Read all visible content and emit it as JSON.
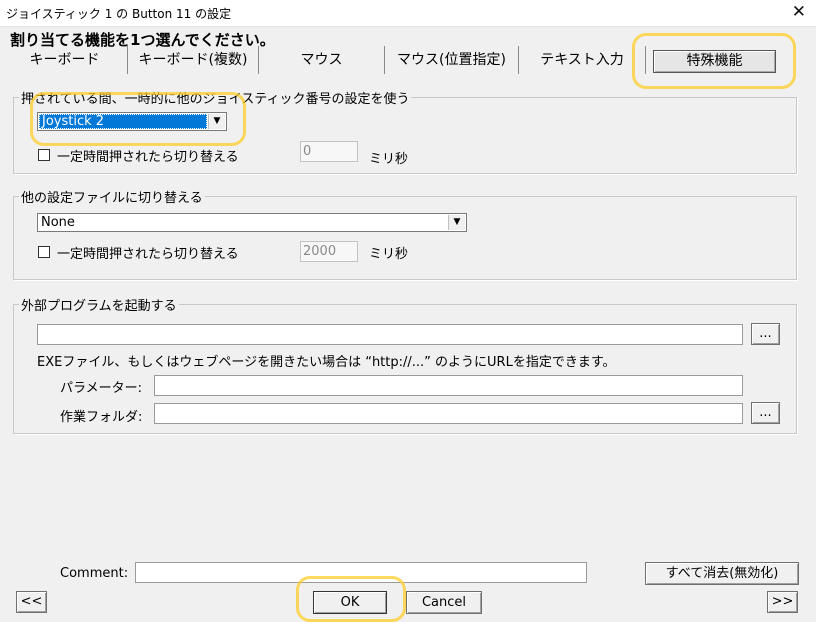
{
  "window": {
    "title": "ジョイスティック 1 の Button 11 の設定",
    "close_glyph": "✕"
  },
  "heading": "割り当てる機能を1つ選んでください。",
  "tabs": [
    {
      "label": "キーボード"
    },
    {
      "label": "キーボード(複数)"
    },
    {
      "label": "マウス"
    },
    {
      "label": "マウス(位置指定)"
    },
    {
      "label": "テキスト入力"
    },
    {
      "label": "特殊機能",
      "selected": true
    }
  ],
  "joystick_group": {
    "legend": "押されている間、一時的に他のジョイスティック番号の設定を使う",
    "select_value": "Joystick 2",
    "toggle_label": "一定時間押されたら切り替える",
    "time_value": "0",
    "unit": "ミリ秒"
  },
  "file_group": {
    "legend": "他の設定ファイルに切り替える",
    "select_value": "None",
    "toggle_label": "一定時間押されたら切り替える",
    "time_value": "2000",
    "unit": "ミリ秒"
  },
  "program_group": {
    "legend": "外部プログラムを起動する",
    "path_value": "",
    "browse_label": "...",
    "hint": "EXEファイル、もしくはウェブページを開きたい場合は “http://...” のようにURLを指定できます。",
    "params_label": "パラメーター:",
    "params_value": "",
    "workdir_label": "作業フォルダ:",
    "workdir_value": "",
    "workdir_browse_label": "..."
  },
  "footer": {
    "comment_label": "Comment:",
    "comment_value": "",
    "clear_all_label": "すべて消去(無効化)",
    "prev_label": "<<",
    "next_label": ">>",
    "ok_label": "OK",
    "cancel_label": "Cancel"
  }
}
